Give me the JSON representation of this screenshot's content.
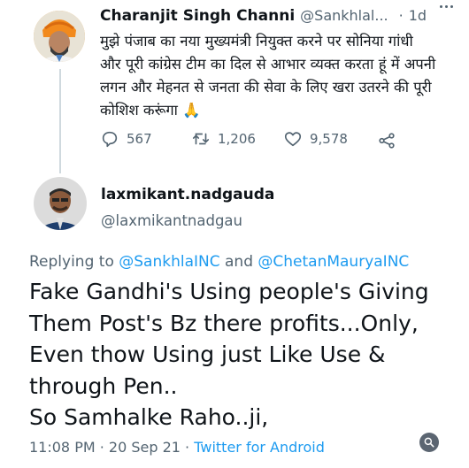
{
  "original_tweet": {
    "author_name": "Charanjit Singh Channi",
    "author_handle": "@Sankhlal...",
    "separator": "·",
    "time_ago": "1d",
    "text": "मुझे पंजाब का नया मुख्यमंत्री नियुक्त करने पर सोनिया गांधी और पूरी कांग्रेस टीम का दिल से आभार व्यक्त करता हूं में अपनी लगन और मेहनत से जनता की सेवा के लिए खरा उतरने की पूरी कोशिश करूंगा 🙏",
    "replies": "567",
    "retweets": "1,206",
    "likes": "9,578"
  },
  "reply_tweet": {
    "author_name": "laxmikant.nadgauda",
    "author_handle": "@laxmikantnadgau",
    "replying_prefix": "Replying to",
    "replying_to_1": "@SankhlaINC",
    "replying_and": "and",
    "replying_to_2": "@ChetanMauryaINC",
    "body_lines": [
      "Fake Gandhi's Using people's Giving",
      "Them Post's Bz there profits...Only,",
      "Even thow Using just Like Use &",
      "through Pen..",
      "So Samhalke Raho..ji,"
    ],
    "timestamp": "11:08 PM · 20 Sep 21",
    "meta_separator": "·",
    "source": "Twitter for Android"
  },
  "colors": {
    "text": "#0f1419",
    "secondary": "#536471",
    "link": "#1d9bf0",
    "thread_line": "#cfd9de"
  }
}
